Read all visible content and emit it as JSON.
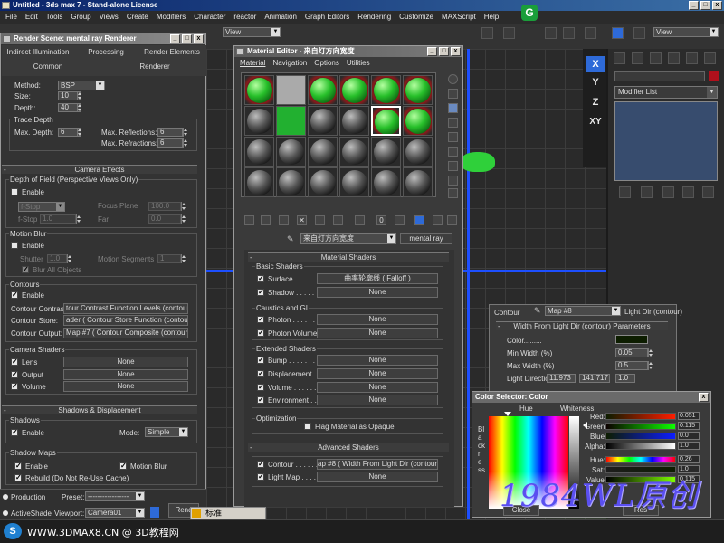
{
  "window": {
    "title": "Untitled - 3ds max 7 - Stand-alone License"
  },
  "menu": [
    "File",
    "Edit",
    "Tools",
    "Group",
    "Views",
    "Create",
    "Modifiers",
    "Character",
    "reactor",
    "Animation",
    "Graph Editors",
    "Rendering",
    "Customize",
    "MAXScript",
    "Help"
  ],
  "toolbar": {
    "view_left": "View",
    "view_right": "View"
  },
  "viewport": {
    "axes": [
      "X",
      "Y",
      "Z",
      "XY"
    ]
  },
  "command_panel": {
    "modifier_list": "Modifier List"
  },
  "render_scene": {
    "title": "Render Scene: mental ray Renderer",
    "tabs_row1": [
      "Indirect Illumination",
      "Processing",
      "Render Elements"
    ],
    "tabs_row2": [
      "Common",
      "Renderer"
    ],
    "method_label": "Method:",
    "method_value": "BSP",
    "size_label": "Size:",
    "size_value": "10",
    "depth_label": "Depth:",
    "depth_value": "40",
    "trace_depth": "Trace Depth",
    "max_depth_label": "Max. Depth:",
    "max_depth_value": "6",
    "max_reflections_label": "Max. Reflections:",
    "max_reflections_value": "6",
    "max_refractions_label": "Max. Refractions:",
    "max_refractions_value": "6",
    "camera_effects": "Camera Effects",
    "dof_group": "Depth of Field (Perspective Views Only)",
    "dof_enable": "Enable",
    "fstop_mode": "f-Stop",
    "focus_plane_label": "Focus Plane",
    "focus_plane_value": "100.0",
    "fstop_label": "f-Stop",
    "fstop_value": "1.0",
    "far_label": "Far",
    "far_value": "0.0",
    "motion_blur_group": "Motion Blur",
    "mb_enable": "Enable",
    "shutter_label": "Shutter",
    "shutter_value": "1.0",
    "motion_segments_label": "Motion Segments",
    "motion_segments_value": "1",
    "blur_all": "Blur All Objects",
    "contours_group": "Contours",
    "contours_enable": "Enable",
    "contour_contrast_label": "Contour Contrast:",
    "contour_contrast_value": "tour Contrast Function Levels (contour) ]",
    "contour_store_label": "Contour Store:",
    "contour_store_value": "ader  ( Contour Store Function (contour) ]",
    "contour_output_label": "Contour Output:",
    "contour_output_value": "Map #7  ( Contour Composite (contour) ]",
    "camera_shaders_group": "Camera Shaders",
    "lens": "Lens",
    "output": "Output",
    "volume": "Volume",
    "none": "None",
    "shadows_disp": "Shadows & Displacement",
    "shadows_group": "Shadows",
    "shadows_enable": "Enable",
    "mode_label": "Mode:",
    "mode_value": "Simple",
    "shadow_maps_group": "Shadow Maps",
    "sm_enable": "Enable",
    "sm_motion_blur": "Motion Blur",
    "rebuild": "Rebuild (Do Not Re-Use Cache)",
    "production": "Production",
    "preset_label": "Preset:",
    "preset_value": "-----------------",
    "activeshade": "ActiveShade",
    "viewport_label": "Viewport:",
    "viewport_value": "Camera01",
    "render_button": "Rend"
  },
  "material_editor": {
    "title": "Material Editor - 来自灯方向宽度",
    "menus": [
      "Material",
      "Navigation",
      "Options",
      "Utilities"
    ],
    "material_name": "来自灯方向宽度",
    "material_type": "mental ray",
    "material_shaders": "Material Shaders",
    "basic_shaders": "Basic Shaders",
    "surface_label": "Surface . . . . . .",
    "surface_value": "曲率轮廓线 ( Falloff )",
    "shadow_label": "Shadow . . . . . .",
    "shadow_value": "None",
    "caustics_gi": "Caustics and GI",
    "photon_label": "Photon . . . . . .",
    "photon_value": "None",
    "photon_volume_label": "Photon Volume .",
    "photon_volume_value": "None",
    "extended_shaders": "Extended Shaders",
    "bump_label": "Bump . . . . . . .",
    "bump_value": "None",
    "displacement_label": "Displacement . .",
    "displacement_value": "None",
    "volume_label": "Volume . . . . . .",
    "volume_value": "None",
    "environment_label": "Environment . . .",
    "environment_value": "None",
    "optimization": "Optimization",
    "flag_opaque": "Flag Material as Opaque",
    "advanced_shaders": "Advanced Shaders",
    "contour_label": "Contour . . . . . .",
    "contour_value": "ap #8  ( Width From Light Dir (contour) ]",
    "light_map_label": "Light Map . . . . .",
    "light_map_value": "None",
    "slot_grid": [
      [
        "green",
        "flat",
        "green",
        "green",
        "green",
        "green"
      ],
      [
        "gray",
        "flatg",
        "gray",
        "gray",
        "greensel",
        "green"
      ],
      [
        "gray",
        "gray",
        "gray",
        "gray",
        "gray",
        "gray"
      ],
      [
        "gray",
        "gray",
        "gray",
        "gray",
        "gray",
        "gray"
      ]
    ]
  },
  "map_dialog": {
    "contour_label": "Contour",
    "map_name": "Map #8",
    "map_type": "Light Dir (contour)",
    "params_title": "Width From Light Dir (contour) Parameters",
    "color_label": "Color.........",
    "min_width_label": "Min Width (%)",
    "min_width_value": "0.05",
    "max_width_label": "Max Width (%)",
    "max_width_value": "0.5",
    "light_direction_label": "Light Direction",
    "light_dir_x": "11.973",
    "light_dir_y": "141.717",
    "light_dir_z": "1.0"
  },
  "color_selector": {
    "title": "Color Selector: Color",
    "hue_label": "Hue",
    "whiteness_label": "Whiteness",
    "blackness_label": "Blackness",
    "red_label": "Red:",
    "red_value": "0.051",
    "green_label": "Green:",
    "green_value": "0.115",
    "blue_label": "Blue:",
    "blue_value": "0.0",
    "alpha_label": "Alpha:",
    "alpha_value": "1.0",
    "hue2_label": "Hue:",
    "hue_value": "0.26",
    "sat_label": "Sat:",
    "sat_value": "1.0",
    "value_label": "Value:",
    "value_value": "0.115",
    "close_button": "Close",
    "reset_button": "Res"
  },
  "taskbar": {
    "lang": "标准",
    "logo": "S",
    "site": "WWW.3DMAX8.CN @ 3D教程网"
  },
  "watermark": "1984WL原创",
  "colors": {
    "title_blue": "#0a246a",
    "selection_blue": "#2e6ad8",
    "green_material": "#22b030",
    "watermark": "#5a4ff0"
  }
}
